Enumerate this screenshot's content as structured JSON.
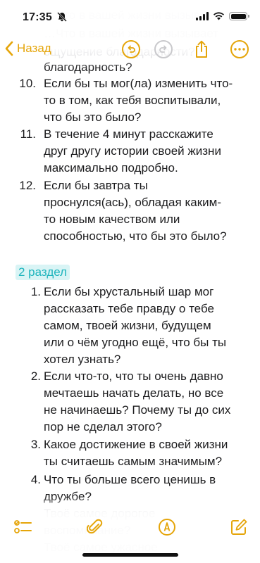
{
  "status": {
    "time": "17:35"
  },
  "nav": {
    "back_label": "Назад"
  },
  "colors": {
    "accent": "#e5a50a",
    "section_tag_bg": "#d9f4f5",
    "section_tag_text": "#1fb5bd"
  },
  "faded_top": {
    "line1": "благодарность?",
    "line2": "…Что в вашей жизни вызывает",
    "line3": "ощущение благодарности?"
  },
  "section1": {
    "items": [
      {
        "n": "",
        "lines": [
          "благодарность?"
        ]
      },
      {
        "n": "10.",
        "lines": [
          "Если бы ты мог(ла) изменить что-",
          "то в том, как тебя воспитывали,",
          "что бы это было?"
        ]
      },
      {
        "n": "11.",
        "lines": [
          "В течение 4 минут расскажите",
          "друг другу истории своей жизни",
          "максимально подробно."
        ]
      },
      {
        "n": "12.",
        "lines": [
          "Если бы завтра ты",
          "проснулся(ась), обладая каким-",
          "то новым качеством или",
          "способностью, что бы это было?"
        ]
      }
    ]
  },
  "section2": {
    "title": "2 раздел",
    "items": [
      {
        "n": "1.",
        "lines": [
          "Если бы хрустальный шар мог",
          "рассказать тебе правду о тебе",
          "самом, твоей жизни, будущем",
          "или о чём угодно ещё, что бы ты",
          "хотел узнать?"
        ]
      },
      {
        "n": "2.",
        "lines": [
          "Если что-то, что ты очень давно",
          "мечтаешь начать делать, но все",
          "не начинаешь? Почему ты до сих",
          "пор не сделал этого?"
        ]
      },
      {
        "n": "3.",
        "lines": [
          "Какое достижение в своей жизни",
          "ты считаешь самым значимым?"
        ]
      },
      {
        "n": "4.",
        "lines": [
          "Что ты больше всего ценишь в",
          "дружбе?"
        ]
      }
    ]
  },
  "faded_bottom": {
    "line1": "Твоё самое дорогое",
    "line2": "воспоминание?",
    "line3": "Твоё самое ужасное"
  },
  "toolbar": {
    "icons": [
      "checklist-icon",
      "attachment-icon",
      "markup-pen-icon",
      "compose-icon"
    ]
  }
}
